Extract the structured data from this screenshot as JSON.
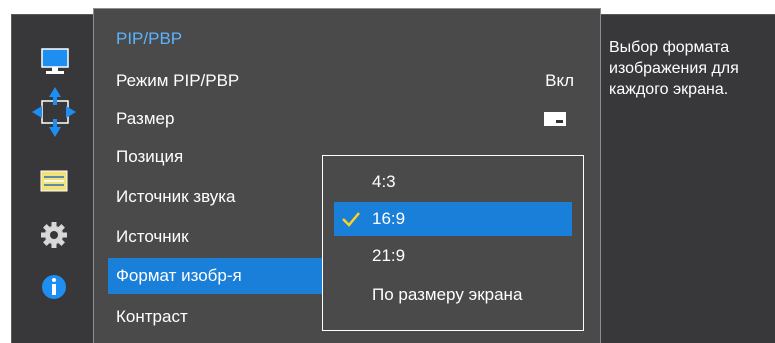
{
  "menu": {
    "title": "PIP/PBP",
    "items": [
      {
        "label": "Режим PIP/PBP",
        "value": "Вкл"
      },
      {
        "label": "Размер",
        "value_icon": "pip-size-icon"
      },
      {
        "label": "Позиция"
      },
      {
        "label": "Источник звука"
      },
      {
        "label": "Источник"
      },
      {
        "label": "Формат изобр-я",
        "selected": true
      },
      {
        "label": "Контраст"
      }
    ]
  },
  "dropdown": {
    "options": [
      {
        "label": "4:3"
      },
      {
        "label": "16:9",
        "selected": true
      },
      {
        "label": "21:9"
      },
      {
        "label": "По размеру экрана"
      }
    ]
  },
  "help": {
    "text": "Выбор формата изображения для каждого экрана."
  },
  "sidebar": {
    "icons": [
      "monitor-icon",
      "resize-arrows-icon",
      "menu-list-icon",
      "gear-icon",
      "info-icon"
    ]
  },
  "colors": {
    "accent": "#1a7fd9",
    "title": "#5ab4ff",
    "panel": "#4a4a4b",
    "sidebar": "#38383a"
  }
}
